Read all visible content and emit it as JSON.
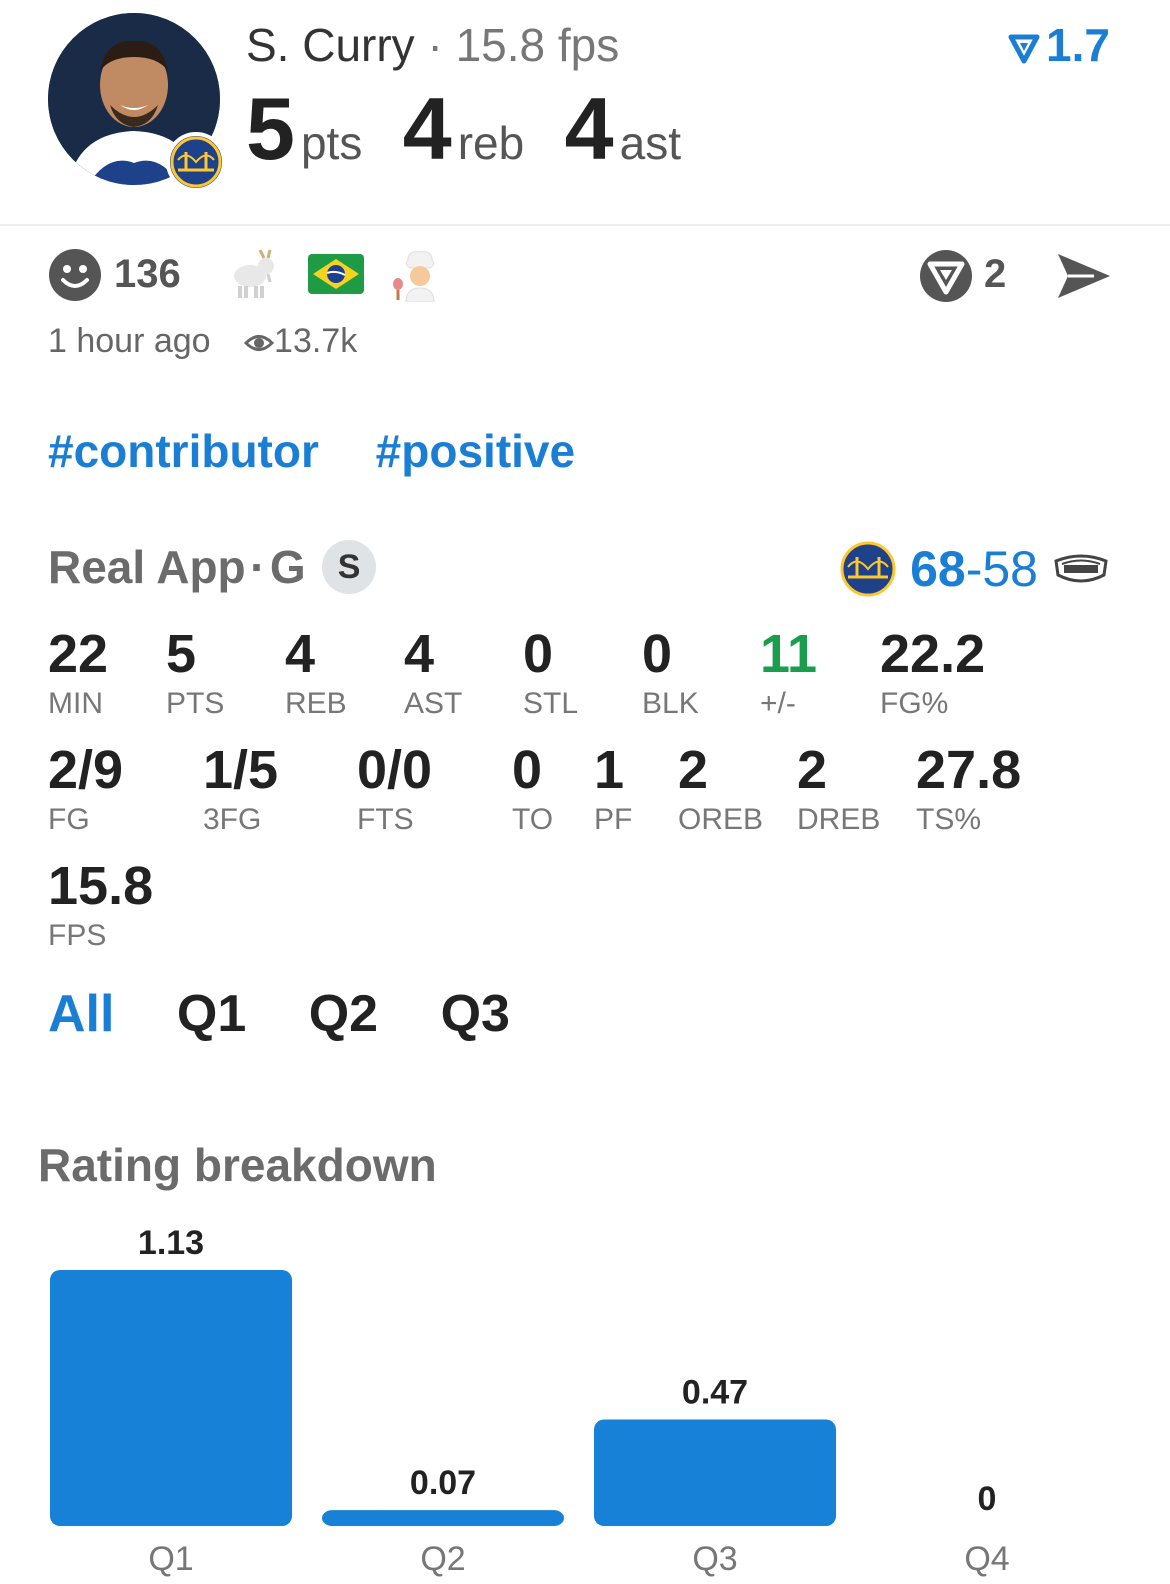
{
  "colors": {
    "accent": "#1a7fd4",
    "positive": "#1a9d4c",
    "bar": "#1681d6"
  },
  "player": {
    "name": "S. Curry",
    "separator": "·",
    "fps_text": "15.8 fps",
    "rating": "1.7",
    "rating_icon": "rating-triangle-icon",
    "pts": "5",
    "pts_unit": "pts",
    "reb": "4",
    "reb_unit": "reb",
    "ast": "4",
    "ast_unit": "ast"
  },
  "reactions": {
    "smile_count": "136",
    "emojis": [
      "🐐",
      "🇧🇷",
      "👨‍🍳"
    ],
    "comment_count": "2"
  },
  "meta": {
    "time": "1 hour ago",
    "views": "13.7k"
  },
  "tags": [
    "#contributor",
    "#positive"
  ],
  "game": {
    "source": "Real App",
    "separator": "·",
    "position": "G",
    "badge": "S",
    "home_score": "68",
    "dash": "-",
    "away_score": "58"
  },
  "stats": [
    {
      "v": "22",
      "l": "MIN"
    },
    {
      "v": "5",
      "l": "PTS"
    },
    {
      "v": "4",
      "l": "REB"
    },
    {
      "v": "4",
      "l": "AST"
    },
    {
      "v": "0",
      "l": "STL"
    },
    {
      "v": "0",
      "l": "BLK"
    },
    {
      "v": "11",
      "l": "+/-"
    },
    {
      "v": "22.2",
      "l": "FG%"
    },
    {
      "v": "2/9",
      "l": "FG"
    },
    {
      "v": "1/5",
      "l": "3FG"
    },
    {
      "v": "0/0",
      "l": "FTS"
    },
    {
      "v": "0",
      "l": "TO"
    },
    {
      "v": "1",
      "l": "PF"
    },
    {
      "v": "2",
      "l": "OREB"
    },
    {
      "v": "2",
      "l": "DREB"
    },
    {
      "v": "27.8",
      "l": "TS%"
    },
    {
      "v": "15.8",
      "l": "FPS"
    }
  ],
  "quarter_tabs": [
    "All",
    "Q1",
    "Q2",
    "Q3"
  ],
  "breakdown_title": "Rating breakdown",
  "chart_data": {
    "type": "bar",
    "categories": [
      "Q1",
      "Q2",
      "Q3",
      "Q4"
    ],
    "values": [
      1.13,
      0.07,
      0.47,
      0
    ],
    "value_labels": [
      "1.13",
      "0.07",
      "0.47",
      "0"
    ],
    "ylim": [
      0,
      1.13
    ],
    "grid": false
  }
}
